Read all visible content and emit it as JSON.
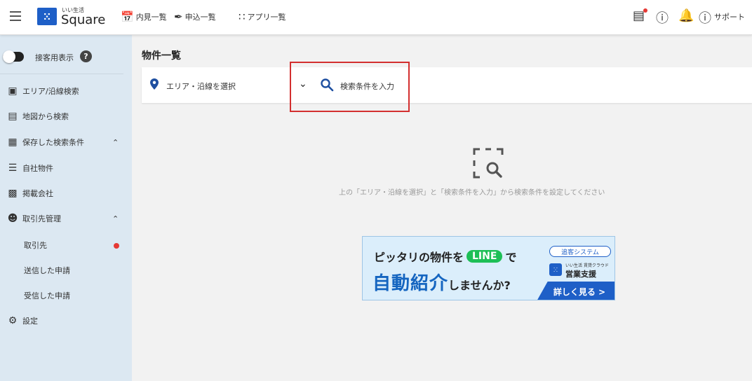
{
  "header": {
    "logo_small": "いい生活",
    "logo_text": "Square",
    "logo_mark": "ⵘ",
    "nav": [
      {
        "label": "内見一覧",
        "icon": "calendar-clock-icon"
      },
      {
        "label": "申込一覧",
        "icon": "pen-icon"
      },
      {
        "label": "アプリ一覧",
        "icon": "grid-icon"
      }
    ],
    "support_label": "サポート"
  },
  "sidebar": {
    "toggle_label": "接客用表示",
    "items": [
      {
        "label": "エリア/沿線検索",
        "icon": "train-icon"
      },
      {
        "label": "地図から検索",
        "icon": "map-icon"
      },
      {
        "label": "保存した検索条件",
        "icon": "saved-search-icon"
      },
      {
        "label": "自社物件",
        "icon": "list-icon"
      },
      {
        "label": "掲載会社",
        "icon": "building-icon"
      },
      {
        "label": "取引先管理",
        "icon": "people-icon"
      },
      {
        "label": "設定",
        "icon": "gear-icon"
      }
    ],
    "sub_items": [
      "取引先",
      "送信した申請",
      "受信した申請"
    ]
  },
  "main": {
    "title": "物件一覧",
    "area_select": "エリア・沿線を選択",
    "condition_input": "検索条件を入力",
    "empty_message": "上の「エリア・沿線を選択」と「検索条件を入力」から検索条件を設定してください"
  },
  "banner": {
    "line1_a": "ピッタリの物件を",
    "line1_badge": "LINE",
    "line1_b": "で",
    "line2_a": "自動紹介",
    "line2_b": "しませんか?",
    "pill": "追客システム",
    "cloud": "いい生活 賃貸クラウド",
    "service": "営業支援",
    "cta": "詳しく見る >"
  },
  "colors": {
    "brand": "#1e5fc7",
    "sidebar_bg": "#dce8f2",
    "highlight": "#d32f2f",
    "line_green": "#1dbf56"
  }
}
